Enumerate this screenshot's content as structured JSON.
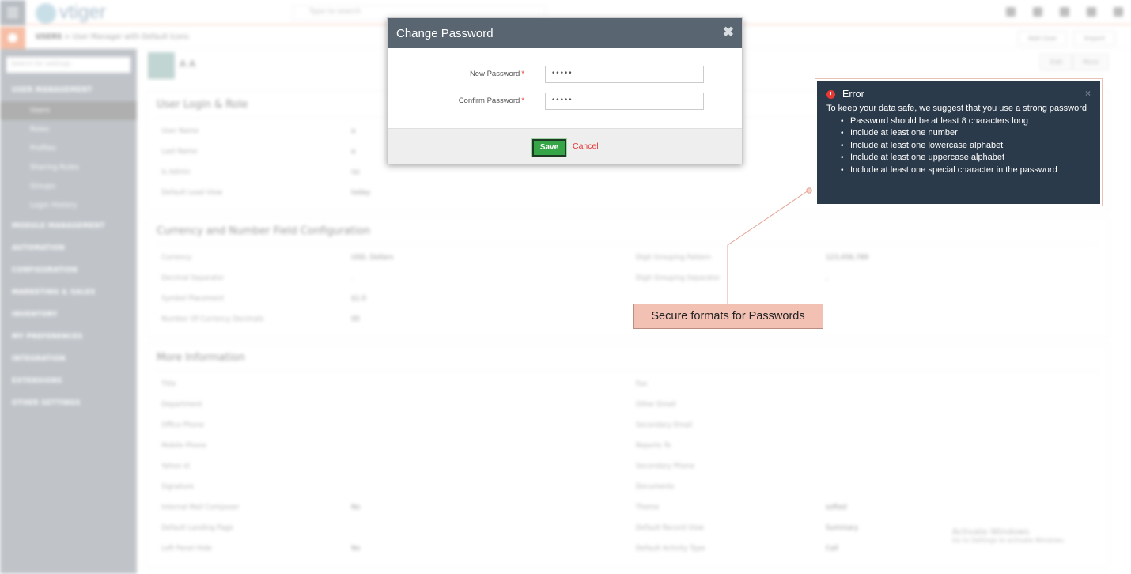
{
  "app": {
    "logo_text": "vtiger",
    "search_placeholder": "Type to search",
    "breadcrumb": {
      "root": "USERS",
      "current": "User Manager with Default Icons"
    },
    "sub_actions": [
      "Add User",
      "Import"
    ]
  },
  "sidebar": {
    "search_placeholder": "Search for settings",
    "groups": [
      {
        "label": "USER MANAGEMENT",
        "items": [
          "Users",
          "Roles",
          "Profiles",
          "Sharing Rules",
          "Groups",
          "Login History"
        ],
        "active_index": 0
      },
      {
        "label": "MODULE MANAGEMENT"
      },
      {
        "label": "AUTOMATION"
      },
      {
        "label": "CONFIGURATION"
      },
      {
        "label": "MARKETING & SALES"
      },
      {
        "label": "INVENTORY"
      },
      {
        "label": "MY PREFERENCES"
      },
      {
        "label": "INTEGRATION"
      },
      {
        "label": "EXTENSIONS"
      },
      {
        "label": "OTHER SETTINGS"
      }
    ]
  },
  "user_detail": {
    "name": "A A",
    "buttons": [
      "Edit",
      "More"
    ],
    "blocks": [
      {
        "title": "User Login & Role",
        "rows": [
          [
            "User Name",
            "a",
            "",
            ""
          ],
          [
            "Last Name",
            "a",
            "",
            ""
          ],
          [
            "Is Admin",
            "no",
            "",
            ""
          ],
          [
            "Default Lead View",
            "today",
            "",
            ""
          ]
        ]
      },
      {
        "title": "Currency and Number Field Configuration",
        "rows": [
          [
            "Currency",
            "USD, Dollars",
            "Digit Grouping Pattern",
            "123,456,789"
          ],
          [
            "Decimal Separator",
            ".",
            "Digit Grouping Separator",
            ","
          ],
          [
            "Symbol Placement",
            "$1.0",
            "",
            ""
          ],
          [
            "Number Of Currency Decimals",
            "00",
            "",
            ""
          ]
        ]
      },
      {
        "title": "More Information",
        "rows": [
          [
            "Title",
            "",
            "Fax",
            ""
          ],
          [
            "Department",
            "",
            "Other Email",
            ""
          ],
          [
            "Office Phone",
            "",
            "Secondary Email",
            ""
          ],
          [
            "Mobile Phone",
            "",
            "Reports To",
            ""
          ],
          [
            "Yahoo id",
            "",
            "Secondary Phone",
            ""
          ],
          [
            "Signature",
            "",
            "Documents",
            ""
          ],
          [
            "Internal Mail Composer",
            "No",
            "Theme",
            "softed"
          ],
          [
            "Default Landing Page",
            "",
            "Default Record View",
            "Summary"
          ],
          [
            "Left Panel Hide",
            "No",
            "Default Activity Type",
            "Call"
          ]
        ]
      }
    ],
    "activate_windows": {
      "title": "Activate Windows",
      "subtitle": "Go to Settings to activate Windows."
    }
  },
  "modal": {
    "title": "Change Password",
    "fields": [
      {
        "label": "New Password",
        "required": "*",
        "value": "•••••",
        "type": "password"
      },
      {
        "label": "Confirm Password",
        "required": "*",
        "value": "•••••",
        "type": "password"
      }
    ],
    "save_label": "Save",
    "cancel_label": "Cancel"
  },
  "error_tooltip": {
    "title": "Error",
    "message": "To keep your data safe, we suggest that you use a strong password",
    "rules": [
      "Password should be at least 8 characters long",
      "Include at least one number",
      "Include at least one lowercase alphabet",
      "Include at least one uppercase alphabet",
      "Include at least one special character in the password"
    ],
    "close_glyph": "×"
  },
  "callout": {
    "text": "Secure formats for Passwords"
  },
  "colors": {
    "modal_header": "#596672",
    "save_green": "#35a547",
    "cancel_red": "#e53935",
    "error_bg": "#2b3a4a",
    "callout_bg": "#f2c1b4",
    "callout_line": "#e3a393"
  }
}
